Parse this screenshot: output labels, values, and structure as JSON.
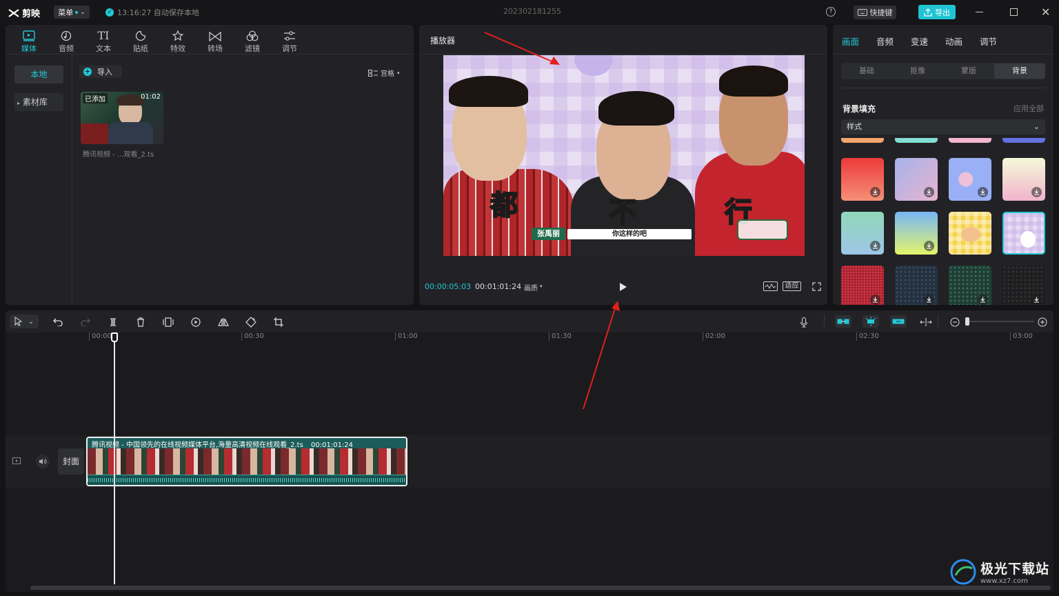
{
  "app": {
    "logo_text": "剪映",
    "menu_label": "菜单",
    "autosave": "13:16:27 自动保存本地",
    "project_name": "202302181255",
    "shortcut_label": "快捷键",
    "export_label": "导出"
  },
  "media_tabs": [
    {
      "label": "媒体",
      "icon": "media-icon"
    },
    {
      "label": "音频",
      "icon": "audio-icon"
    },
    {
      "label": "文本",
      "icon": "text-icon"
    },
    {
      "label": "贴纸",
      "icon": "sticker-icon"
    },
    {
      "label": "特效",
      "icon": "effects-icon"
    },
    {
      "label": "转场",
      "icon": "transition-icon"
    },
    {
      "label": "滤镜",
      "icon": "filter-icon"
    },
    {
      "label": "调节",
      "icon": "adjust-icon"
    }
  ],
  "media_sidebar": {
    "local": "本地",
    "library": "素材库"
  },
  "media_panel": {
    "import_label": "导入",
    "view_label": "宫格",
    "clip": {
      "badge": "已添加",
      "duration": "01:02",
      "name": "腾讯视频 - ...观看_2.ts"
    }
  },
  "player": {
    "title": "播放器",
    "current_time": "00:00:05:03",
    "total_time": "00:01:01:24",
    "quality_label": "画质",
    "fit_label": "适应",
    "video_caption": {
      "char1": "都",
      "char2": "不",
      "char3": "行",
      "name_tag": "张禹丽",
      "subtitle": "你这样的吧"
    }
  },
  "props": {
    "tabs": [
      "画面",
      "音频",
      "变速",
      "动画",
      "调节"
    ],
    "segments": [
      "基础",
      "抠像",
      "蒙版",
      "背景"
    ],
    "section_title": "背景填充",
    "apply_all": "应用全部",
    "style_select": "样式"
  },
  "timeline": {
    "ruler": [
      "00:00",
      "00:30",
      "01:00",
      "01:30",
      "02:00",
      "02:30",
      "03:00"
    ],
    "cover_label": "封面",
    "clip_title": "腾讯视频 - 中国领先的在线视频媒体平台,海量高清视频在线观看_2.ts",
    "clip_duration": "00:01:01:24"
  },
  "watermark": {
    "text": "极光下载站",
    "url": "www.xz7.com"
  },
  "colors": {
    "accent": "#22c9d6",
    "export_bg": "#1fc3d2",
    "arrow": "#e0201c",
    "clip_bg": "#1c5c5a"
  }
}
